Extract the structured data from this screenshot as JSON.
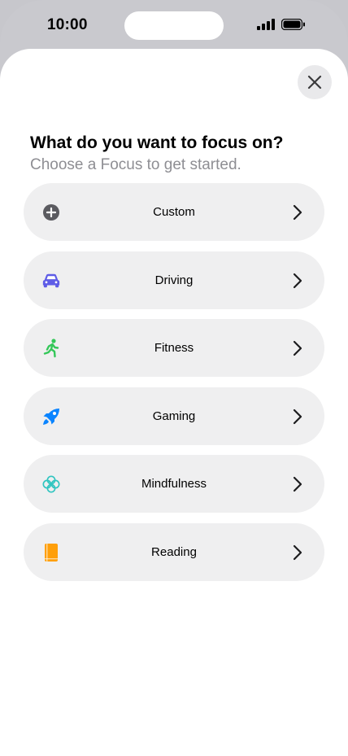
{
  "status_bar": {
    "time": "10:00"
  },
  "sheet": {
    "title": "What do you want to focus on?",
    "subtitle": "Choose a Focus to get started."
  },
  "focus_options": [
    {
      "label": "Custom",
      "icon": "plus-circle-icon",
      "color": "#6d6d72"
    },
    {
      "label": "Driving",
      "icon": "car-icon",
      "color": "#5e5ce6"
    },
    {
      "label": "Fitness",
      "icon": "running-figure-icon",
      "color": "#34c759"
    },
    {
      "label": "Gaming",
      "icon": "rocket-icon",
      "color": "#0a84ff"
    },
    {
      "label": "Mindfulness",
      "icon": "flower-icon",
      "color": "#30c5c0"
    },
    {
      "label": "Reading",
      "icon": "book-icon",
      "color": "#ff9f0a"
    }
  ]
}
